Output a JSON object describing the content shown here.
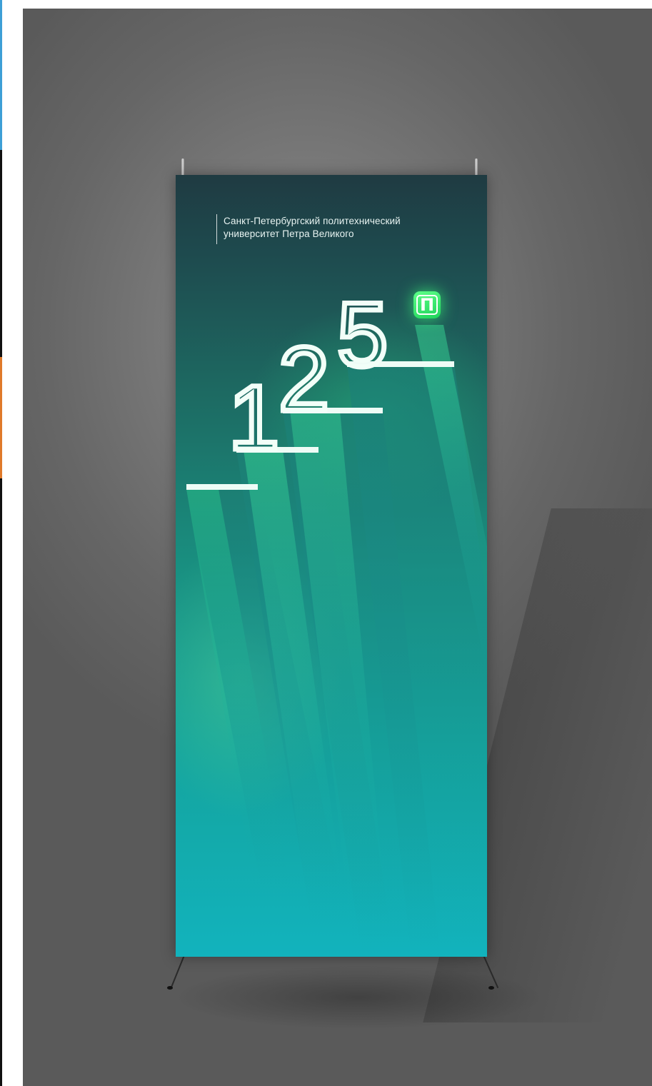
{
  "banner": {
    "header_line1": "Санкт-Петербургский политехнический",
    "header_line2": "университет Петра Великого",
    "anniversary_digit_1": "1",
    "anniversary_digit_2": "2",
    "anniversary_digit_3": "5",
    "logo_letter": "П"
  },
  "colors": {
    "banner_top": "#1f3b42",
    "banner_bottom": "#12b3bd",
    "logo_green": "#2ee86a",
    "backdrop_gray": "#6e6e6e"
  }
}
